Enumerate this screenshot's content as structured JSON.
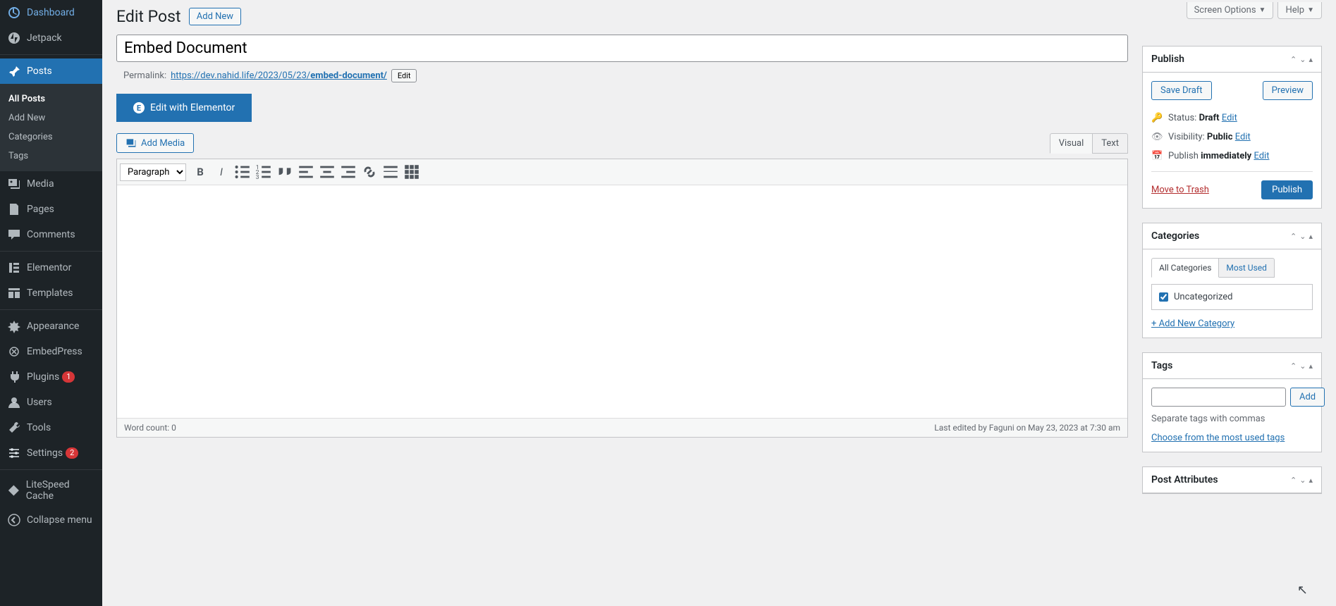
{
  "topActions": {
    "screenOptions": "Screen Options",
    "help": "Help"
  },
  "sidebar": {
    "items": [
      {
        "label": "Dashboard"
      },
      {
        "label": "Jetpack"
      },
      {
        "label": "Posts"
      },
      {
        "label": "Media"
      },
      {
        "label": "Pages"
      },
      {
        "label": "Comments"
      },
      {
        "label": "Elementor"
      },
      {
        "label": "Templates"
      },
      {
        "label": "Appearance"
      },
      {
        "label": "EmbedPress"
      },
      {
        "label": "Plugins",
        "badge": "1"
      },
      {
        "label": "Users"
      },
      {
        "label": "Tools"
      },
      {
        "label": "Settings",
        "badge": "2"
      },
      {
        "label": "LiteSpeed Cache"
      },
      {
        "label": "Collapse menu"
      }
    ],
    "submenu": [
      {
        "label": "All Posts"
      },
      {
        "label": "Add New"
      },
      {
        "label": "Categories"
      },
      {
        "label": "Tags"
      }
    ]
  },
  "page": {
    "title": "Edit Post",
    "addNew": "Add New",
    "postTitle": "Embed Document",
    "permalinkLabel": "Permalink:",
    "permalinkBase": "https://dev.nahid.life/2023/05/23/",
    "permalinkSlug": "embed-document/",
    "permalinkEdit": "Edit",
    "elementorBtn": "Edit with Elementor",
    "addMedia": "Add Media",
    "tabs": {
      "visual": "Visual",
      "text": "Text"
    },
    "formatSelect": "Paragraph",
    "wordCount": "Word count: 0",
    "lastEdited": "Last edited by Faguni on May 23, 2023 at 7:30 am"
  },
  "publish": {
    "title": "Publish",
    "saveDraft": "Save Draft",
    "preview": "Preview",
    "statusLabel": "Status:",
    "statusValue": "Draft",
    "visibilityLabel": "Visibility:",
    "visibilityValue": "Public",
    "publishLabel": "Publish",
    "publishValue": "immediately",
    "edit": "Edit",
    "trash": "Move to Trash",
    "publishBtn": "Publish"
  },
  "categories": {
    "title": "Categories",
    "allTab": "All Categories",
    "mostUsedTab": "Most Used",
    "item": "Uncategorized",
    "addNew": "+ Add New Category"
  },
  "tags": {
    "title": "Tags",
    "add": "Add",
    "help": "Separate tags with commas",
    "choose": "Choose from the most used tags"
  },
  "postAttributes": {
    "title": "Post Attributes"
  }
}
